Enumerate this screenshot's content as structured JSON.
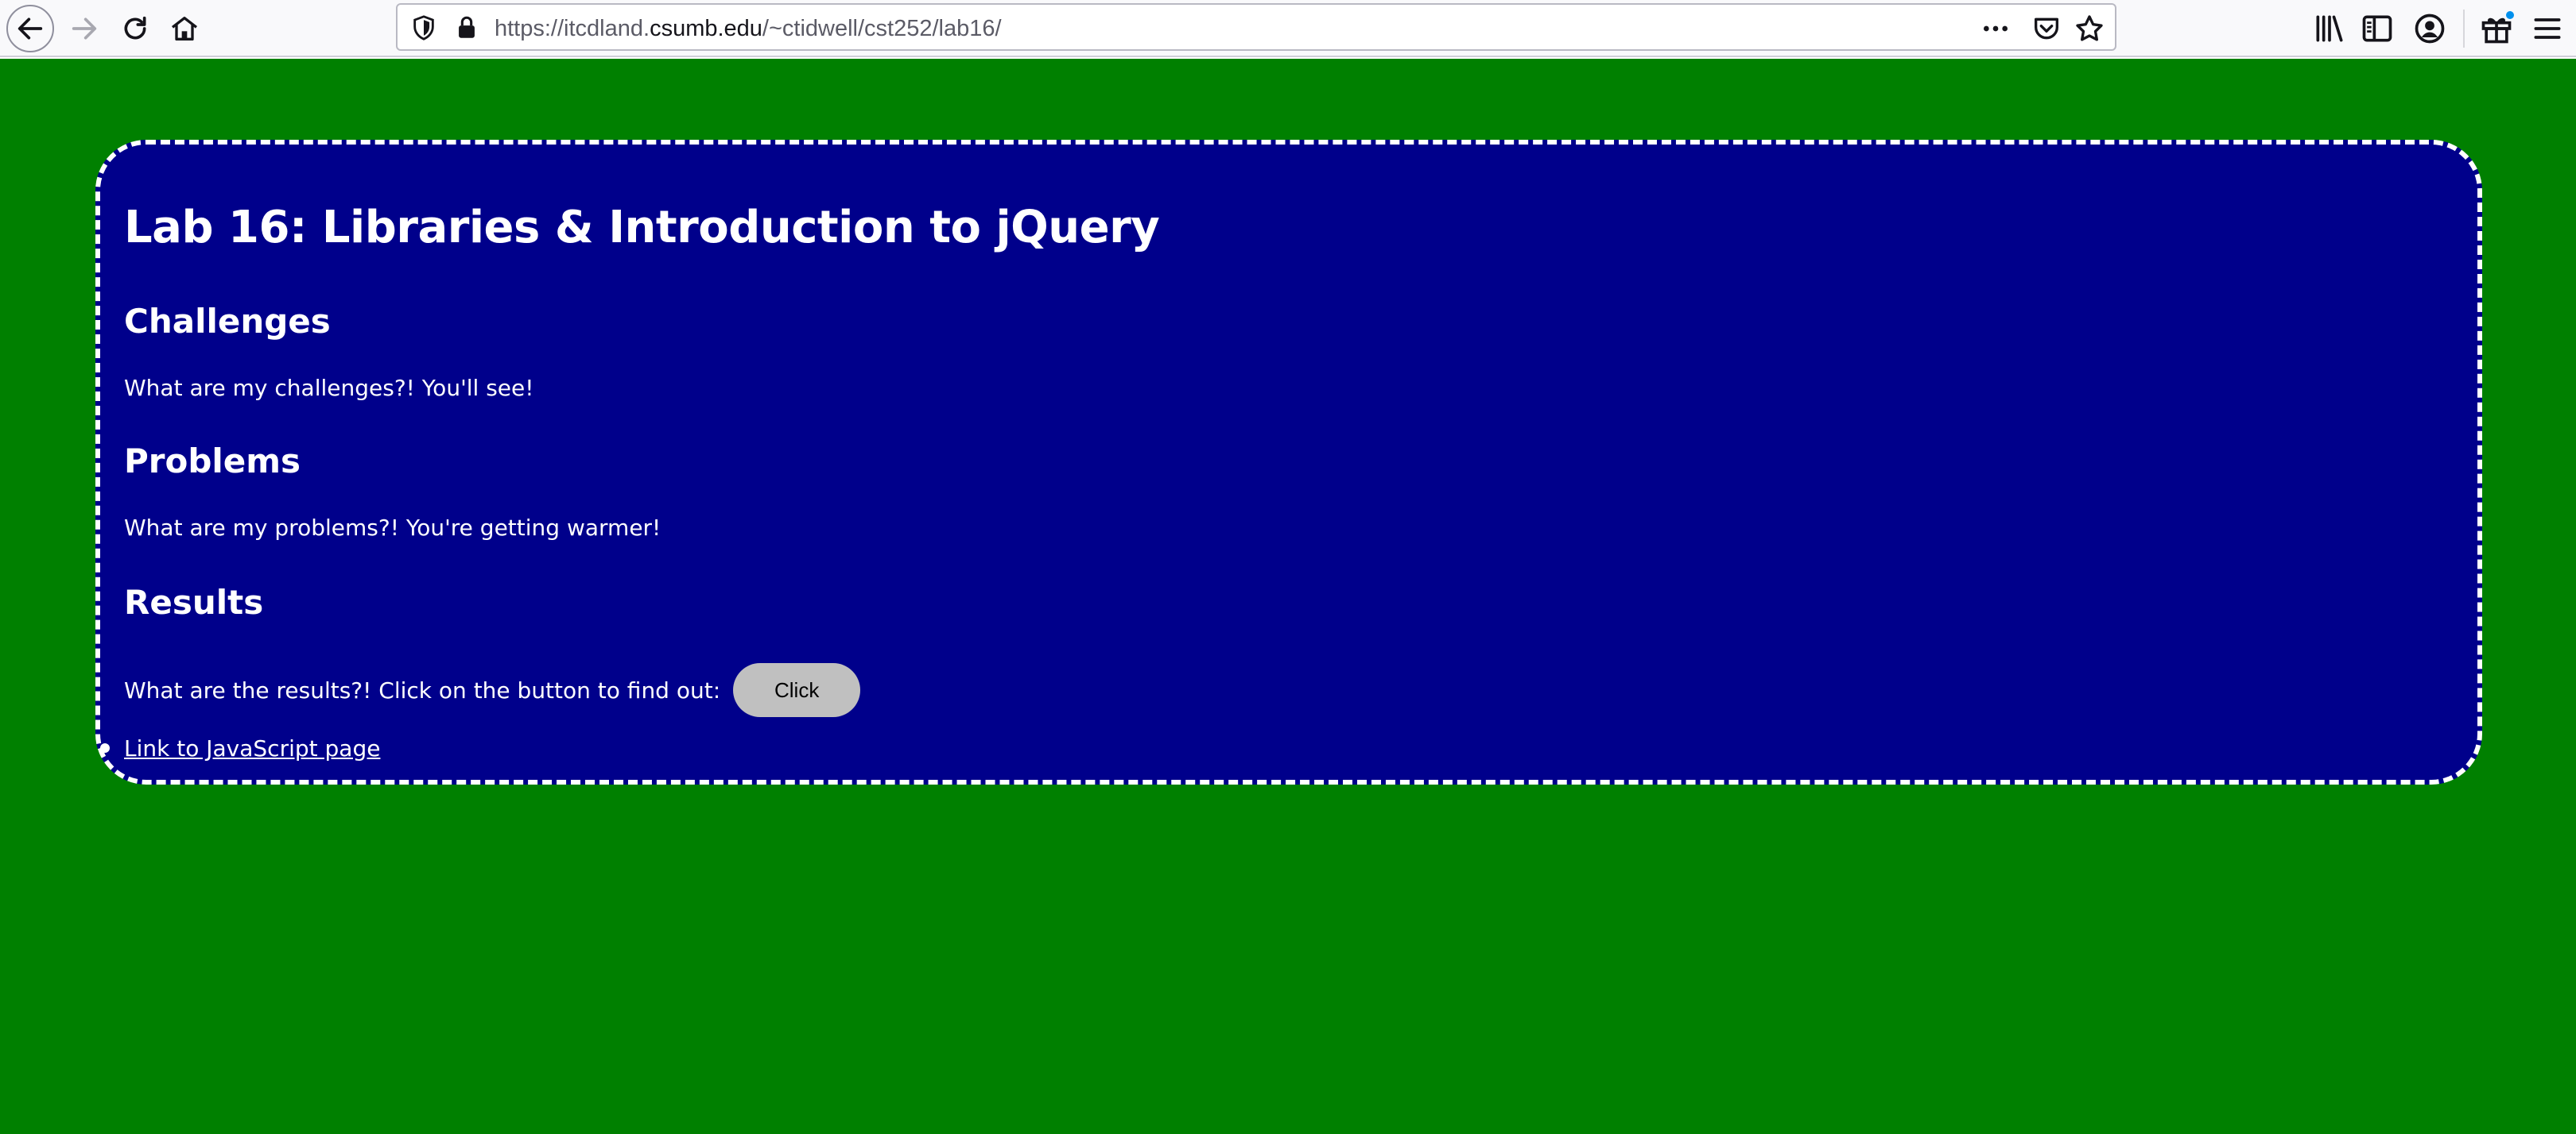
{
  "browser": {
    "url_prefix": "https://itcdland.",
    "url_domain": "csumb.edu",
    "url_path": "/~ctidwell/cst252/lab16/",
    "icons": {
      "back": "arrow-left-icon",
      "forward": "arrow-right-icon",
      "reload": "reload-icon",
      "home": "home-icon",
      "shield": "tracking-shield-icon",
      "lock": "lock-icon",
      "page_actions": "more-dots-icon",
      "pocket": "pocket-icon",
      "bookmark": "star-icon",
      "library": "library-icon",
      "sidebar": "sidebar-icon",
      "account": "account-icon",
      "whats_new": "gift-icon",
      "menu": "hamburger-menu-icon"
    }
  },
  "page": {
    "background_color": "#008000",
    "card_color": "#00008b",
    "title": "Lab 16: Libraries & Introduction to jQuery",
    "sections": [
      {
        "heading": "Challenges",
        "text": "What are my challenges?! You'll see!"
      },
      {
        "heading": "Problems",
        "text": "What are my problems?! You're getting warmer!"
      },
      {
        "heading": "Results",
        "text": "What are the results?! Click on the button to find out:"
      }
    ],
    "button_label": "Click",
    "link_text": "Link to JavaScript page"
  }
}
